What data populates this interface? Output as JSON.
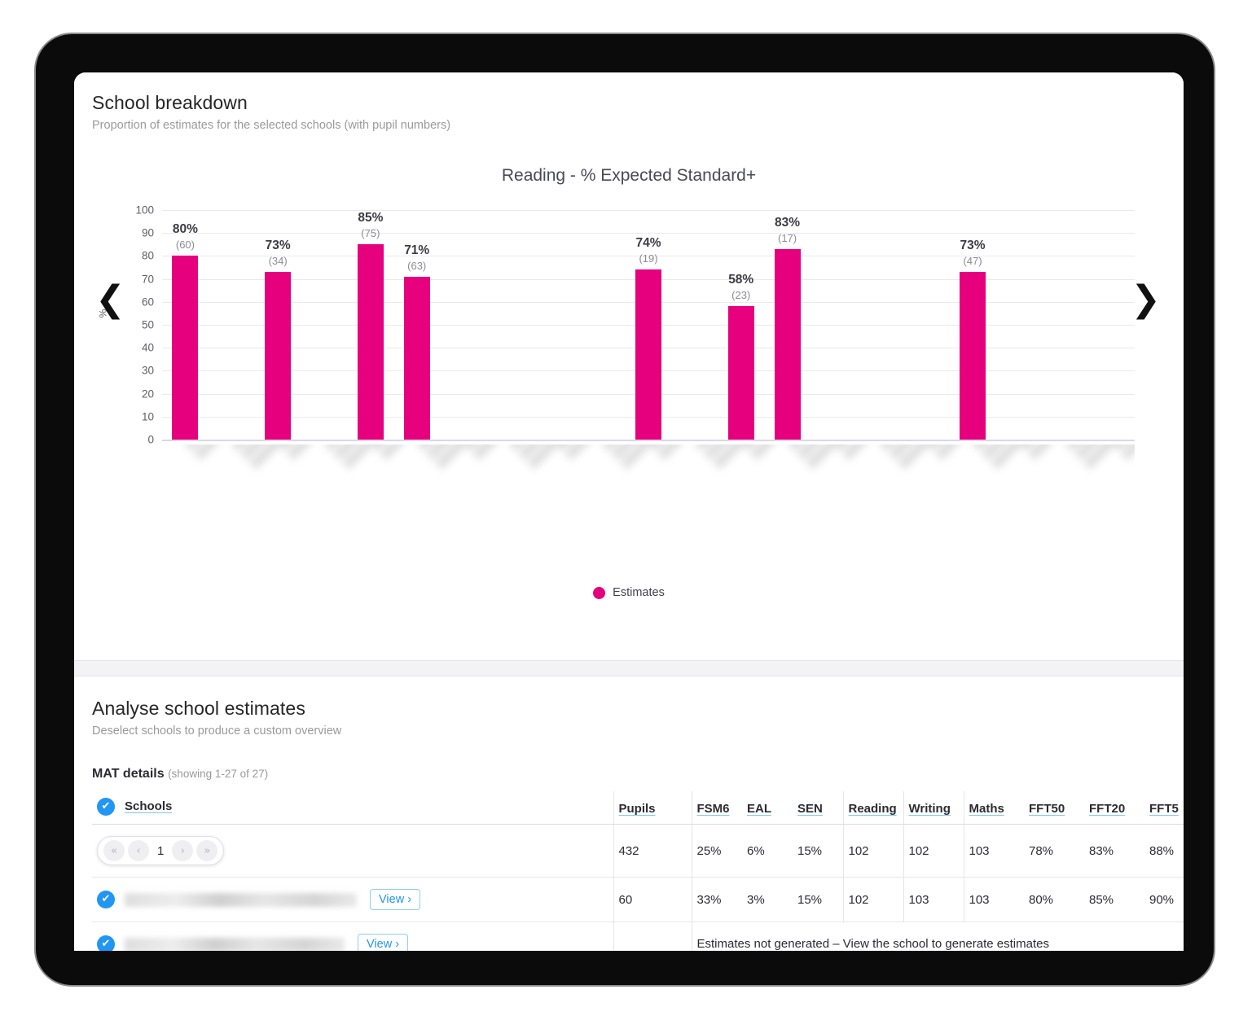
{
  "chart_card": {
    "title": "School breakdown",
    "subtitle": "Proportion of estimates for the selected schools (with pupil numbers)",
    "prev_arrow": "❮",
    "next_arrow": "❯",
    "legend_label": "Estimates",
    "accent_color": "#e6007e"
  },
  "chart_data": {
    "type": "bar",
    "title": "Reading - % Expected Standard+",
    "xlabel": "",
    "ylabel": "%",
    "ylim": [
      0,
      100
    ],
    "yticks": [
      100,
      90,
      80,
      70,
      60,
      50,
      40,
      30,
      20,
      10,
      0
    ],
    "grid": true,
    "legend": [
      "Estimates"
    ],
    "legend_position": "bottom-center",
    "series_color": "#e6007e",
    "bar_slots": 21,
    "categories": [
      "school-1",
      "school-2",
      "school-3",
      "school-4",
      "school-5",
      "school-6",
      "school-7",
      "school-8",
      "school-9",
      "school-10",
      "school-11",
      "school-12",
      "school-13",
      "school-14",
      "school-15",
      "school-16",
      "school-17",
      "school-18",
      "school-19",
      "school-20",
      "school-21"
    ],
    "points": [
      {
        "slot": 0,
        "value": 80,
        "label": "80%",
        "pupils": "(60)"
      },
      {
        "slot": 2,
        "value": 73,
        "label": "73%",
        "pupils": "(34)"
      },
      {
        "slot": 4,
        "value": 85,
        "label": "85%",
        "pupils": "(75)"
      },
      {
        "slot": 5,
        "value": 71,
        "label": "71%",
        "pupils": "(63)"
      },
      {
        "slot": 10,
        "value": 74,
        "label": "74%",
        "pupils": "(19)"
      },
      {
        "slot": 12,
        "value": 58,
        "label": "58%",
        "pupils": "(23)"
      },
      {
        "slot": 13,
        "value": 83,
        "label": "83%",
        "pupils": "(17)"
      },
      {
        "slot": 17,
        "value": 73,
        "label": "73%",
        "pupils": "(47)"
      }
    ],
    "xtick_labels_redacted": true
  },
  "table_card": {
    "title": "Analyse school estimates",
    "subtitle": "Deselect schools to produce a custom overview",
    "mat_label": "MAT details",
    "mat_count": "(showing 1-27 of 27)",
    "check_glyph": "✔",
    "view_label": "View ›",
    "pager": {
      "first": "«",
      "prev": "‹",
      "current": "1",
      "next": "›",
      "last": "»"
    },
    "columns": [
      "Schools",
      "Pupils",
      "FSM6",
      "EAL",
      "SEN",
      "Reading",
      "Writing",
      "Maths",
      "FFT50",
      "FFT20",
      "FFT5"
    ],
    "rows": [
      {
        "name_redacted": false,
        "is_summary": true,
        "pupils": "432",
        "fsm6": "25%",
        "eal": "6%",
        "sen": "15%",
        "reading": "102",
        "writing": "102",
        "maths": "103",
        "fft50": "78%",
        "fft20": "83%",
        "fft5": "88%"
      },
      {
        "name_redacted": true,
        "is_summary": false,
        "pupils": "60",
        "fsm6": "33%",
        "eal": "3%",
        "sen": "15%",
        "reading": "102",
        "writing": "103",
        "maths": "103",
        "fft50": "80%",
        "fft20": "85%",
        "fft5": "90%"
      },
      {
        "name_redacted": true,
        "is_summary": false,
        "no_estimates": "Estimates not generated – View the school to generate estimates"
      }
    ]
  }
}
